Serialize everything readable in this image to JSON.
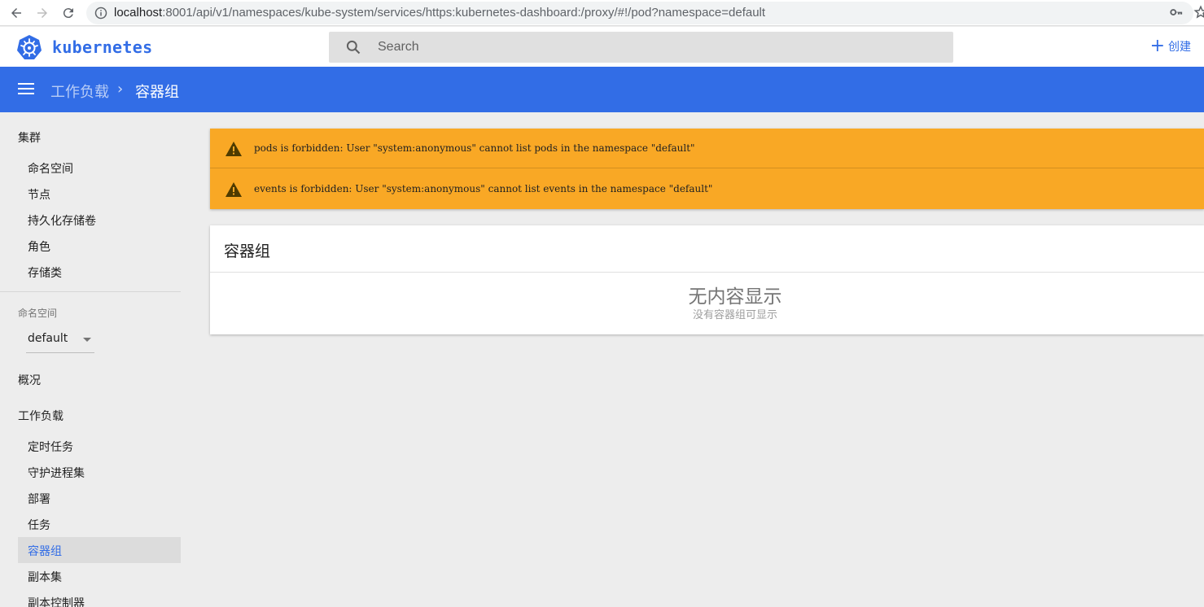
{
  "browser": {
    "url_host": "localhost",
    "url_rest": ":8001/api/v1/namespaces/kube-system/services/https:kubernetes-dashboard:/proxy/#!/pod?namespace=default"
  },
  "header": {
    "brand": "kubernetes",
    "search_placeholder": "Search",
    "create_label": "创建"
  },
  "toolbar": {
    "breadcrumb_parent": "工作负载",
    "breadcrumb_separator": "›",
    "breadcrumb_current": "容器组"
  },
  "sidebar": {
    "cluster_heading": "集群",
    "cluster_items": [
      "命名空间",
      "节点",
      "持久化存储卷",
      "角色",
      "存储类"
    ],
    "namespace_label": "命名空间",
    "namespace_value": "default",
    "overview": "概况",
    "workloads_heading": "工作负载",
    "workload_items": [
      "定时任务",
      "守护进程集",
      "部署",
      "任务",
      "容器组",
      "副本集",
      "副本控制器"
    ],
    "active_item": "容器组"
  },
  "alerts": [
    "pods is forbidden: User \"system:anonymous\" cannot list pods in the namespace \"default\"",
    "events is forbidden: User \"system:anonymous\" cannot list events in the namespace \"default\""
  ],
  "card": {
    "title": "容器组",
    "empty_title": "无内容显示",
    "empty_subtitle": "没有容器组可显示"
  },
  "colors": {
    "primary": "#326de6",
    "warning": "#f9a825",
    "background": "#ededed"
  }
}
